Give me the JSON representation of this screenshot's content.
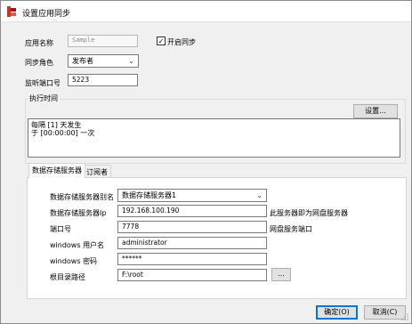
{
  "window": {
    "title": "设置应用同步"
  },
  "form": {
    "app_name_label": "应用名称",
    "app_name_value": "Sample",
    "enable_sync_label": "开启同步",
    "enable_sync_checked": true,
    "sync_role_label": "同步角色",
    "sync_role_value": "发布者",
    "listen_port_label": "监听端口号",
    "listen_port_value": "5223"
  },
  "schedule": {
    "group_title": "执行时间",
    "settings_button": "设置...",
    "lines": [
      "每隔 [1] 天发生",
      "于 [00:00:00] 一次"
    ]
  },
  "tabs": [
    {
      "label": "数据存储服务器",
      "active": true
    },
    {
      "label": "订阅者",
      "active": false
    }
  ],
  "storage": {
    "alias_label": "数据存储服务器别名",
    "alias_value": "数据存储服务器1",
    "ip_label": "数据存储服务器Ip",
    "ip_value": "192.168.100.190",
    "ip_note": "此服务器即为网盘服务器",
    "port_label": "端口号",
    "port_value": "7778",
    "port_note": "网盘服务端口",
    "win_user_label": "windows 用户名",
    "win_user_value": "administrator",
    "win_pass_label": "windows 密码",
    "win_pass_value": "******",
    "root_label": "根目录路径",
    "root_value": "F:\\root",
    "browse_button": "..."
  },
  "footer": {
    "ok_button": "确定(O)",
    "cancel_button": "取消(C)"
  },
  "colors": {
    "accent": "#0078d7",
    "icon": "#c0392b"
  }
}
